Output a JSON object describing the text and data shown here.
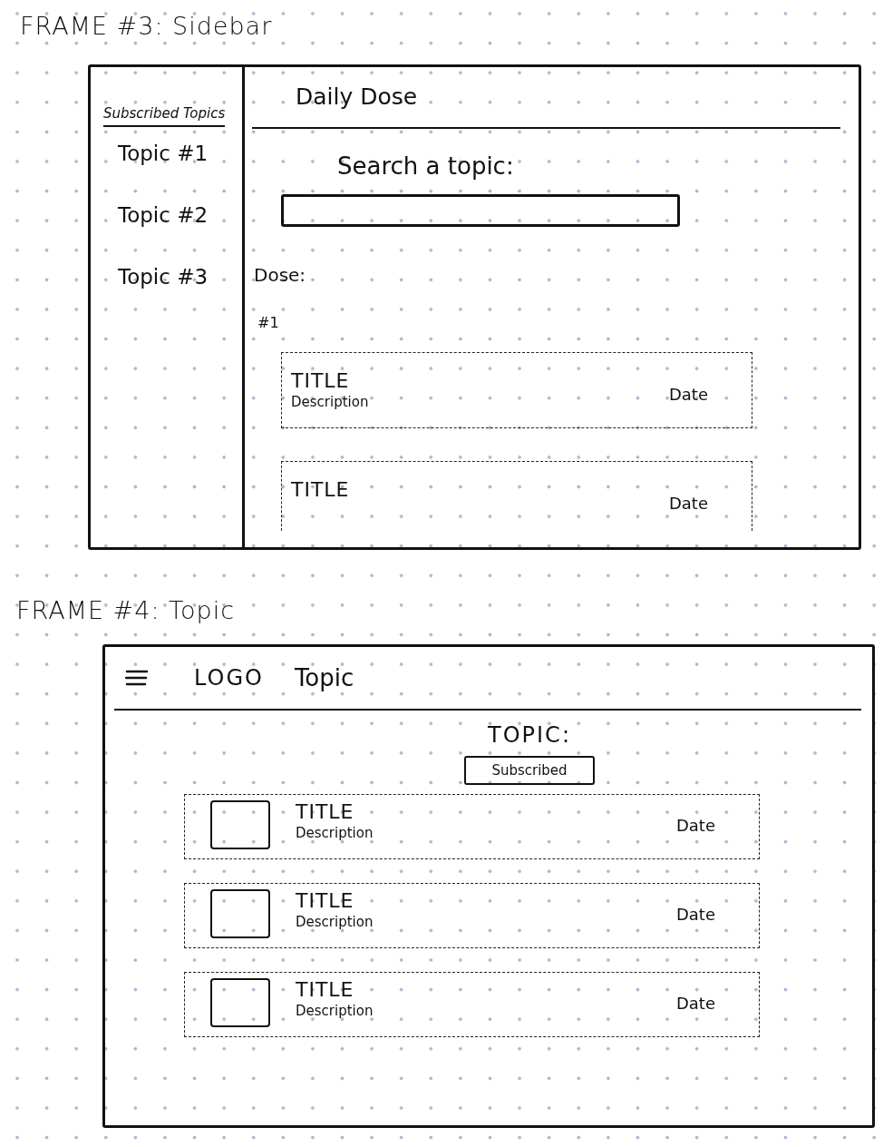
{
  "frames": [
    {
      "kind": "sidebar_layout",
      "heading": "FRAME #3: Sidebar",
      "sidebar": {
        "title": "Subscribed Topics",
        "items": [
          {
            "label": "Topic #1"
          },
          {
            "label": "Topic #2"
          },
          {
            "label": "Topic #3"
          }
        ]
      },
      "header": {
        "title": "Daily Dose"
      },
      "search": {
        "label": "Search a topic:"
      },
      "section": {
        "title": "Dose:",
        "number": "#1"
      },
      "cards": [
        {
          "title": "TITLE",
          "description": "Description",
          "date": "Date"
        },
        {
          "title": "TITLE",
          "date": "Date"
        }
      ]
    },
    {
      "kind": "topic_layout",
      "heading": "FRAME #4: Topic",
      "header": {
        "logo": "LOGO",
        "title": "Topic"
      },
      "topic": {
        "title": "TOPIC:",
        "button": "Subscribed"
      },
      "cards": [
        {
          "title": "TITLE",
          "description": "Description",
          "date": "Date"
        },
        {
          "title": "TITLE",
          "description": "Description",
          "date": "Date"
        },
        {
          "title": "TITLE",
          "description": "Description",
          "date": "Date"
        }
      ]
    }
  ]
}
